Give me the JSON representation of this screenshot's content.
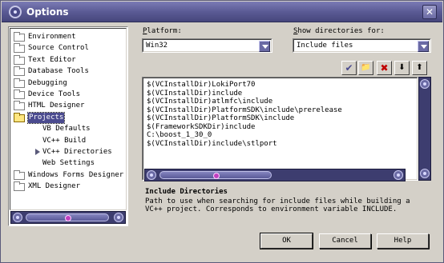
{
  "window": {
    "title": "Options"
  },
  "tree": {
    "items": [
      {
        "label": "Environment",
        "icon": "folder-icon"
      },
      {
        "label": "Source Control",
        "icon": "folder-icon"
      },
      {
        "label": "Text Editor",
        "icon": "folder-icon"
      },
      {
        "label": "Database Tools",
        "icon": "folder-icon"
      },
      {
        "label": "Debugging",
        "icon": "folder-icon"
      },
      {
        "label": "Device Tools",
        "icon": "folder-icon"
      },
      {
        "label": "HTML Designer",
        "icon": "folder-icon"
      },
      {
        "label": "Projects",
        "icon": "folder-open-icon",
        "selected": true
      },
      {
        "label": "VB Defaults",
        "icon": "none"
      },
      {
        "label": "VC++ Build",
        "icon": "none"
      },
      {
        "label": "VC++ Directories",
        "icon": "arrow-icon"
      },
      {
        "label": "Web Settings",
        "icon": "none"
      },
      {
        "label": "Windows Forms Designer",
        "icon": "folder-icon"
      },
      {
        "label": "XML Designer",
        "icon": "folder-icon"
      }
    ]
  },
  "platform": {
    "label_pre": "",
    "label_key": "P",
    "label_post": "latform:",
    "value": "Win32"
  },
  "show_dirs": {
    "label_key": "S",
    "label_post": "how directories for:",
    "value": "Include files"
  },
  "toolbar": {
    "check": "✔",
    "new_folder": "📁",
    "delete": "✖",
    "down": "⬇",
    "up": "⬆"
  },
  "directories": [
    "$(VCInstallDir)LokiPort70",
    "$(VCInstallDir)include",
    "$(VCInstallDir)atlmfc\\include",
    "$(VCInstallDir)PlatformSDK\\include\\prerelease",
    "$(VCInstallDir)PlatformSDK\\include",
    "$(FrameworkSDKDir)include",
    "C:\\boost_1_30_0",
    "$(VCInstallDir)include\\stlport"
  ],
  "description": {
    "title": "Include Directories",
    "line1": "Path to use when searching for include files while building a",
    "line2": "VC++ project.  Corresponds to environment variable INCLUDE."
  },
  "buttons": {
    "ok": "OK",
    "cancel": "Cancel",
    "help": "Help"
  },
  "colors": {
    "accent": "#4b4b8f",
    "titlebar": "#5b5b95",
    "face": "#d4d0c8"
  }
}
